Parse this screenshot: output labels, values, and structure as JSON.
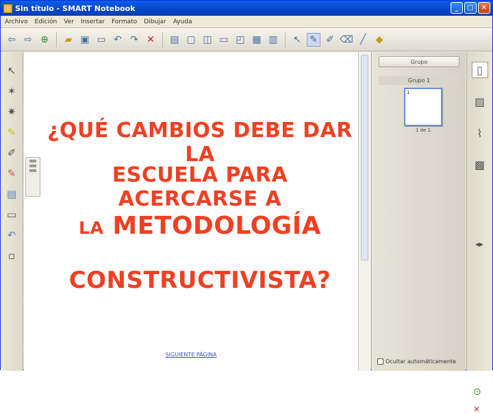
{
  "window": {
    "title": "Sin título - SMART Notebook",
    "minimize_icon": "minimize-icon",
    "maximize_icon": "maximize-icon",
    "close_icon": "close-icon"
  },
  "menubar": {
    "items": [
      "Archivo",
      "Edición",
      "Ver",
      "Insertar",
      "Formato",
      "Dibujar",
      "Ayuda"
    ]
  },
  "toolbar": {
    "icons": [
      "back-arrow-icon",
      "forward-arrow-icon",
      "add-page-icon",
      "open-folder-icon",
      "save-icon",
      "paste-icon",
      "undo-icon",
      "redo-icon",
      "delete-icon",
      "screen-shade-icon",
      "full-screen-icon",
      "dual-page-icon",
      "screen-capture-icon",
      "document-camera-icon",
      "table-icon",
      "properties-icon",
      "select-icon",
      "pen-icon",
      "creative-pen-icon",
      "eraser-icon",
      "line-icon",
      "shapes-icon"
    ]
  },
  "canvas": {
    "heading_line1": "¿QUÉ CAMBIOS DEBE DAR LA",
    "heading_line2": "ESCUELA PARA ACERCARSE A",
    "heading_line3_small": "LA",
    "heading_line3_big": "METODOLOGÍA",
    "heading_line4": "CONSTRUCTIVISTA?",
    "page_link": "SIGUIENTE PÁGINA"
  },
  "sidepanel": {
    "group_button": "Grupo",
    "group_label": "Grupo 1",
    "page_number": "1",
    "page_caption": "1 de 1",
    "autohide_label": "Ocultar automáticamente"
  },
  "colors": {
    "heading": "#ef4023",
    "titlebar": "#0846c9",
    "chrome": "#ece9d8"
  }
}
